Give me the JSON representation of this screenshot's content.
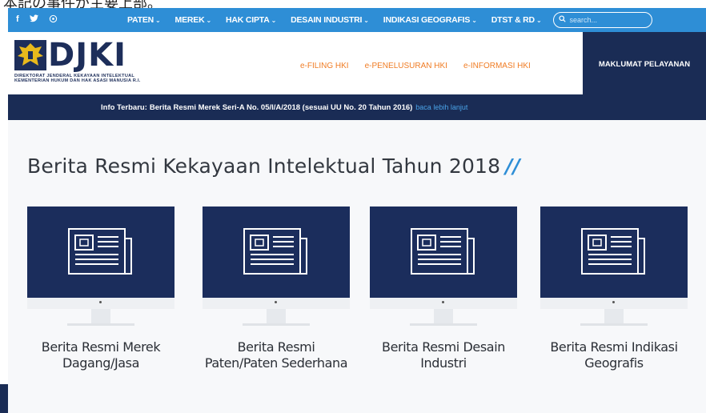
{
  "top_clip_text": "本記の事件が主要上部。",
  "topnav": {
    "social": [
      "f",
      "🐦",
      "◎"
    ],
    "menu": [
      {
        "label": "PATEN"
      },
      {
        "label": "MEREK"
      },
      {
        "label": "HAK CIPTA"
      },
      {
        "label": "DESAIN INDUSTRI"
      },
      {
        "label": "INDIKASI GEOGRAFIS"
      },
      {
        "label": "DTST & RD"
      }
    ],
    "search_placeholder": "search..."
  },
  "header": {
    "logo_text": "DJKI",
    "logo_sub1": "DIREKTORAT JENDERAL KEKAYAAN INTELEKTUAL",
    "logo_sub2": "KEMENTERIAN HUKUM DAN HAK ASASI MANUSIA R.I.",
    "eservices": [
      "e-FILING HKI",
      "e-PENELUSURAN HKI",
      "e-INFORMASI HKI"
    ],
    "maklumat": "MAKLUMAT PELAYANAN"
  },
  "infobar": {
    "label": "Info Terbaru:",
    "text": "Berita Resmi Merek Seri-A No. 05/I/A/2018 (sesuai UU No. 20 Tahun 2016)",
    "more": "baca lebih lanjut"
  },
  "main": {
    "title": "Berita Resmi Kekayaan Intelektual Tahun 2018",
    "title_slash": "//",
    "cards": [
      {
        "line1": "Berita Resmi Merek",
        "line2": "Dagang/Jasa"
      },
      {
        "line1": "Berita Resmi",
        "line2": "Paten/Paten Sederhana"
      },
      {
        "line1": "Berita Resmi Desain",
        "line2": "Industri"
      },
      {
        "line1": "Berita Resmi Indikasi",
        "line2": "Geografis"
      }
    ]
  },
  "colors": {
    "nav_blue": "#2e8ed6",
    "navy": "#1a2c55",
    "orange": "#f07c24"
  }
}
